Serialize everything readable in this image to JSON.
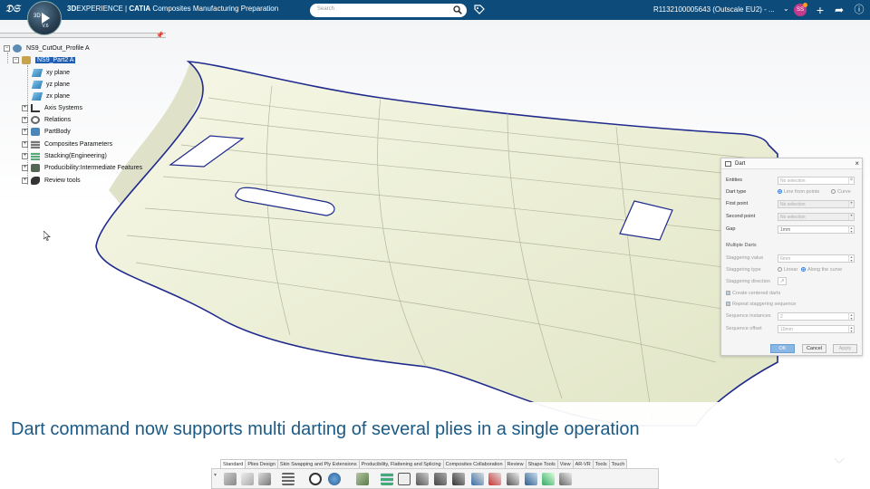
{
  "topbar": {
    "compass_label": "3D",
    "compass_version": "V.6",
    "brand_bold": "3D",
    "brand_rest": "EXPERIENCE",
    "separator": " | ",
    "app_bold": "CATIA",
    "app_name": " Composites Manufacturing Preparation",
    "search_placeholder": "Search",
    "user_label": "R1132100005643  (Outscale EU2) - ...",
    "avatar_initials": "SS",
    "icons": [
      "ds-logo-icon",
      "search-icon",
      "tag-icon",
      "add-icon",
      "share-icon",
      "help-icon"
    ]
  },
  "tree": {
    "root": "NS9_CutOut_Profile A",
    "part": "NS9_Part2 A",
    "items": [
      {
        "label": "xy plane",
        "icon": "plane-icon"
      },
      {
        "label": "yz plane",
        "icon": "plane-icon"
      },
      {
        "label": "zx plane",
        "icon": "plane-icon"
      },
      {
        "label": "Axis Systems",
        "icon": "axis-icon"
      },
      {
        "label": "Relations",
        "icon": "relations-icon"
      },
      {
        "label": "PartBody",
        "icon": "partbody-icon"
      },
      {
        "label": "Composites Parameters",
        "icon": "composites-parameters-icon"
      },
      {
        "label": "Stacking(Engineering)",
        "icon": "stacking-icon"
      },
      {
        "label": "Producibility:Intermediate Features",
        "icon": "producibility-icon"
      },
      {
        "label": "Review tools",
        "icon": "review-tools-icon"
      }
    ]
  },
  "dart": {
    "title": "Dart",
    "entities_label": "Entities",
    "entities_value": "No selection",
    "dart_type_label": "Dart type",
    "dart_type_options": [
      "Line from points",
      "Curve"
    ],
    "first_point_label": "First point",
    "first_point_value": "No selection",
    "second_point_label": "Second point",
    "second_point_value": "No selection",
    "gap_label": "Gap",
    "gap_value": "1mm",
    "multiple_darts_label": "Multiple Darts",
    "staggering_value_label": "Staggering value",
    "staggering_value": "6mm",
    "staggering_type_label": "Staggering type",
    "staggering_type_options": [
      "Linear",
      "Along the curve"
    ],
    "staggering_direction_label": "Staggering direction",
    "create_centered_label": "Create centered darts",
    "repeat_staggering_label": "Repeat staggering sequence",
    "sequence_instances_label": "Sequence instances",
    "sequence_instances_value": "2",
    "sequence_offset_label": "Sequence offset",
    "sequence_offset_value": "10mm",
    "ok_label": "OK",
    "cancel_label": "Cancel",
    "apply_label": "Apply"
  },
  "caption": "Dart command now supports multi darting of several plies in a single operation",
  "toolbar": {
    "tabs": [
      "Standard",
      "Plies Design",
      "Skin Swapping and Ply Extensions",
      "Producibility, Flattening and Splicing",
      "Composites Collaboration",
      "Review",
      "Shape Tools",
      "View",
      "AR-VR",
      "Tools",
      "Touch"
    ],
    "active_tab": "Standard",
    "tools": [
      "cut-icon",
      "copy-icon",
      "paste-icon",
      "tree-list-icon",
      "zoom-icon",
      "update-icon",
      "ply-icon",
      "stacking-tool-icon",
      "sketch-icon",
      "rosette-icon",
      "drape-icon",
      "dart-icon",
      "cutout-icon",
      "flatten-icon",
      "splice-icon",
      "export-icon",
      "review-icon"
    ]
  },
  "colors": {
    "topbar": "#0d4c7a",
    "part_fill": "#eef0dc",
    "part_outline": "#1f2a8c",
    "caption_text": "#1a5a86",
    "tree_selected": "#1e5fb3"
  }
}
